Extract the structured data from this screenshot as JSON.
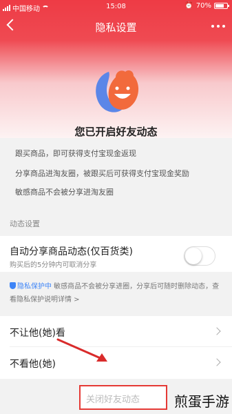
{
  "status_bar": {
    "carrier": "中国移动",
    "time": "15:08",
    "battery": "70%"
  },
  "nav": {
    "title": "隐私设置",
    "back_icon": "chevron-left-icon",
    "more_icon": "more-dots-icon"
  },
  "header": {
    "headline": "您已开启好友动态",
    "features": [
      "跟买商品，即可获得支付宝现金返现",
      "分享商品进淘友圈，被跟买后可获得支付宝现金奖励",
      "敏感商品不会被分享进淘友圈"
    ]
  },
  "section": {
    "label": "动态设置"
  },
  "auto_share": {
    "title": "自动分享商品动态(仅百货类)",
    "subtitle": "购买后的5分钟内可取消分享",
    "enabled": false
  },
  "privacy_note": {
    "tag": "隐私保护中",
    "text": " 敏感商品不会被分享进圈，分享后可随时删除动态，查看隐私保护说明详情 >"
  },
  "rows": [
    {
      "label": "不让他(她)看",
      "icon": "chevron-right-icon"
    },
    {
      "label": "不看他(她)",
      "icon": "chevron-right-icon"
    }
  ],
  "close_button": {
    "label": "关闭好友动态"
  },
  "watermark": "煎蛋手游",
  "colors": {
    "brand_red": "#ee3b45",
    "accent_blue": "#3d84f7",
    "logo_blue": "#5b86e8",
    "logo_orange": "#f26a3c"
  }
}
